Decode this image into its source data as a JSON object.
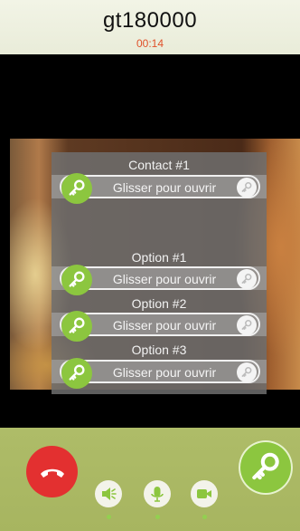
{
  "header": {
    "caller": "gt180000",
    "timer": "00:14"
  },
  "doors": [
    {
      "title": "Contact #1",
      "slider_label": "Glisser pour ouvrir"
    },
    {
      "title": "Option #1",
      "slider_label": "Glisser pour ouvrir"
    },
    {
      "title": "Option #2",
      "slider_label": "Glisser pour ouvrir"
    },
    {
      "title": "Option #3",
      "slider_label": "Glisser pour ouvrir"
    }
  ],
  "controls": {
    "hangup_icon": "phone-hangup-icon",
    "speaker_icon": "speaker-icon",
    "mic_icon": "microphone-icon",
    "camera_icon": "video-camera-icon",
    "answer_icon": "key-icon"
  },
  "colors": {
    "accent_green": "#8cc63f",
    "hangup_red": "#e33030",
    "timer_orange": "#e0512a",
    "bar_green": "#aebc68"
  }
}
